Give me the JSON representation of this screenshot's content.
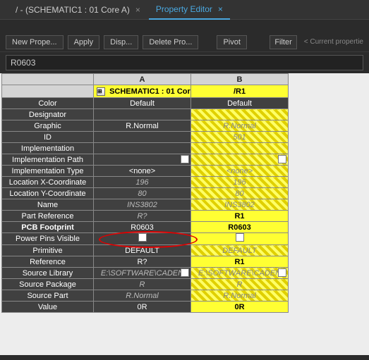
{
  "tabs": {
    "tab1": "/ - (SCHEMATIC1 : 01 Core A)",
    "tab2": "Property Editor"
  },
  "toolbar": {
    "new_prop": "New Prope...",
    "apply": "Apply",
    "display": "Disp...",
    "delete": "Delete Pro...",
    "pivot": "Pivot",
    "filter": "Filter",
    "scroll_hint": "< Current propertie"
  },
  "search_value": "R0603",
  "header": {
    "A": "A",
    "B": "B",
    "schematic_label": "SCHEMATIC1 : 01 Cor",
    "r1": "/R1"
  },
  "rows": [
    {
      "label": "Color",
      "a": "Default",
      "a_style": "plain",
      "b": "Default",
      "b_style": "plain-dark"
    },
    {
      "label": "Designator",
      "a": "",
      "a_style": "empty",
      "b": "",
      "b_style": "hatch"
    },
    {
      "label": "Graphic",
      "a": "R.Normal",
      "a_style": "plain",
      "b": "R.Normal",
      "b_style": "hatch-italic"
    },
    {
      "label": "ID",
      "a": "",
      "a_style": "empty",
      "b": "501",
      "b_style": "hatch-italic"
    },
    {
      "label": "Implementation",
      "a": "",
      "a_style": "empty",
      "b": "",
      "b_style": "hatch"
    },
    {
      "label": "Implementation Path",
      "a": "",
      "a_style": "box-right",
      "b": "",
      "b_style": "hatch-box"
    },
    {
      "label": "Implementation Type",
      "a": "<none>",
      "a_style": "plain",
      "b": "<none>",
      "b_style": "hatch-italic"
    },
    {
      "label": "Location X-Coordinate",
      "a": "196",
      "a_style": "italic",
      "b": "196",
      "b_style": "hatch-italic"
    },
    {
      "label": "Location Y-Coordinate",
      "a": "80",
      "a_style": "italic",
      "b": "80",
      "b_style": "hatch-italic"
    },
    {
      "label": "Name",
      "a": "INS3802",
      "a_style": "italic",
      "b": "INS3802",
      "b_style": "hatch-italic"
    },
    {
      "label": "Part Reference",
      "a": "R?",
      "a_style": "italic",
      "b": "R1",
      "b_style": "solid"
    },
    {
      "label": "PCB Footprint",
      "a": "R0603",
      "a_style": "plain-bold",
      "b": "R0603",
      "b_style": "solid"
    },
    {
      "label": "Power Pins Visible",
      "a": "",
      "a_style": "center-box",
      "b": "",
      "b_style": "solid-center-box"
    },
    {
      "label": "Primitive",
      "a": "DEFAULT",
      "a_style": "plain",
      "b": "DEFAULT",
      "b_style": "hatch-italic"
    },
    {
      "label": "Reference",
      "a": "R?",
      "a_style": "plain",
      "b": "R1",
      "b_style": "solid"
    },
    {
      "label": "Source Library",
      "a": "E:\\SOFTWARE\\CADEN",
      "a_style": "italic-box",
      "b": "E:\\SOFTWARE\\CADEN",
      "b_style": "hatch-box-text"
    },
    {
      "label": "Source Package",
      "a": "R",
      "a_style": "italic",
      "b": "R",
      "b_style": "hatch-italic"
    },
    {
      "label": "Source Part",
      "a": "R.Normal",
      "a_style": "italic",
      "b": "R.Normal",
      "b_style": "hatch-italic"
    },
    {
      "label": "Value",
      "a": "0R",
      "a_style": "plain",
      "b": "0R",
      "b_style": "solid"
    }
  ]
}
